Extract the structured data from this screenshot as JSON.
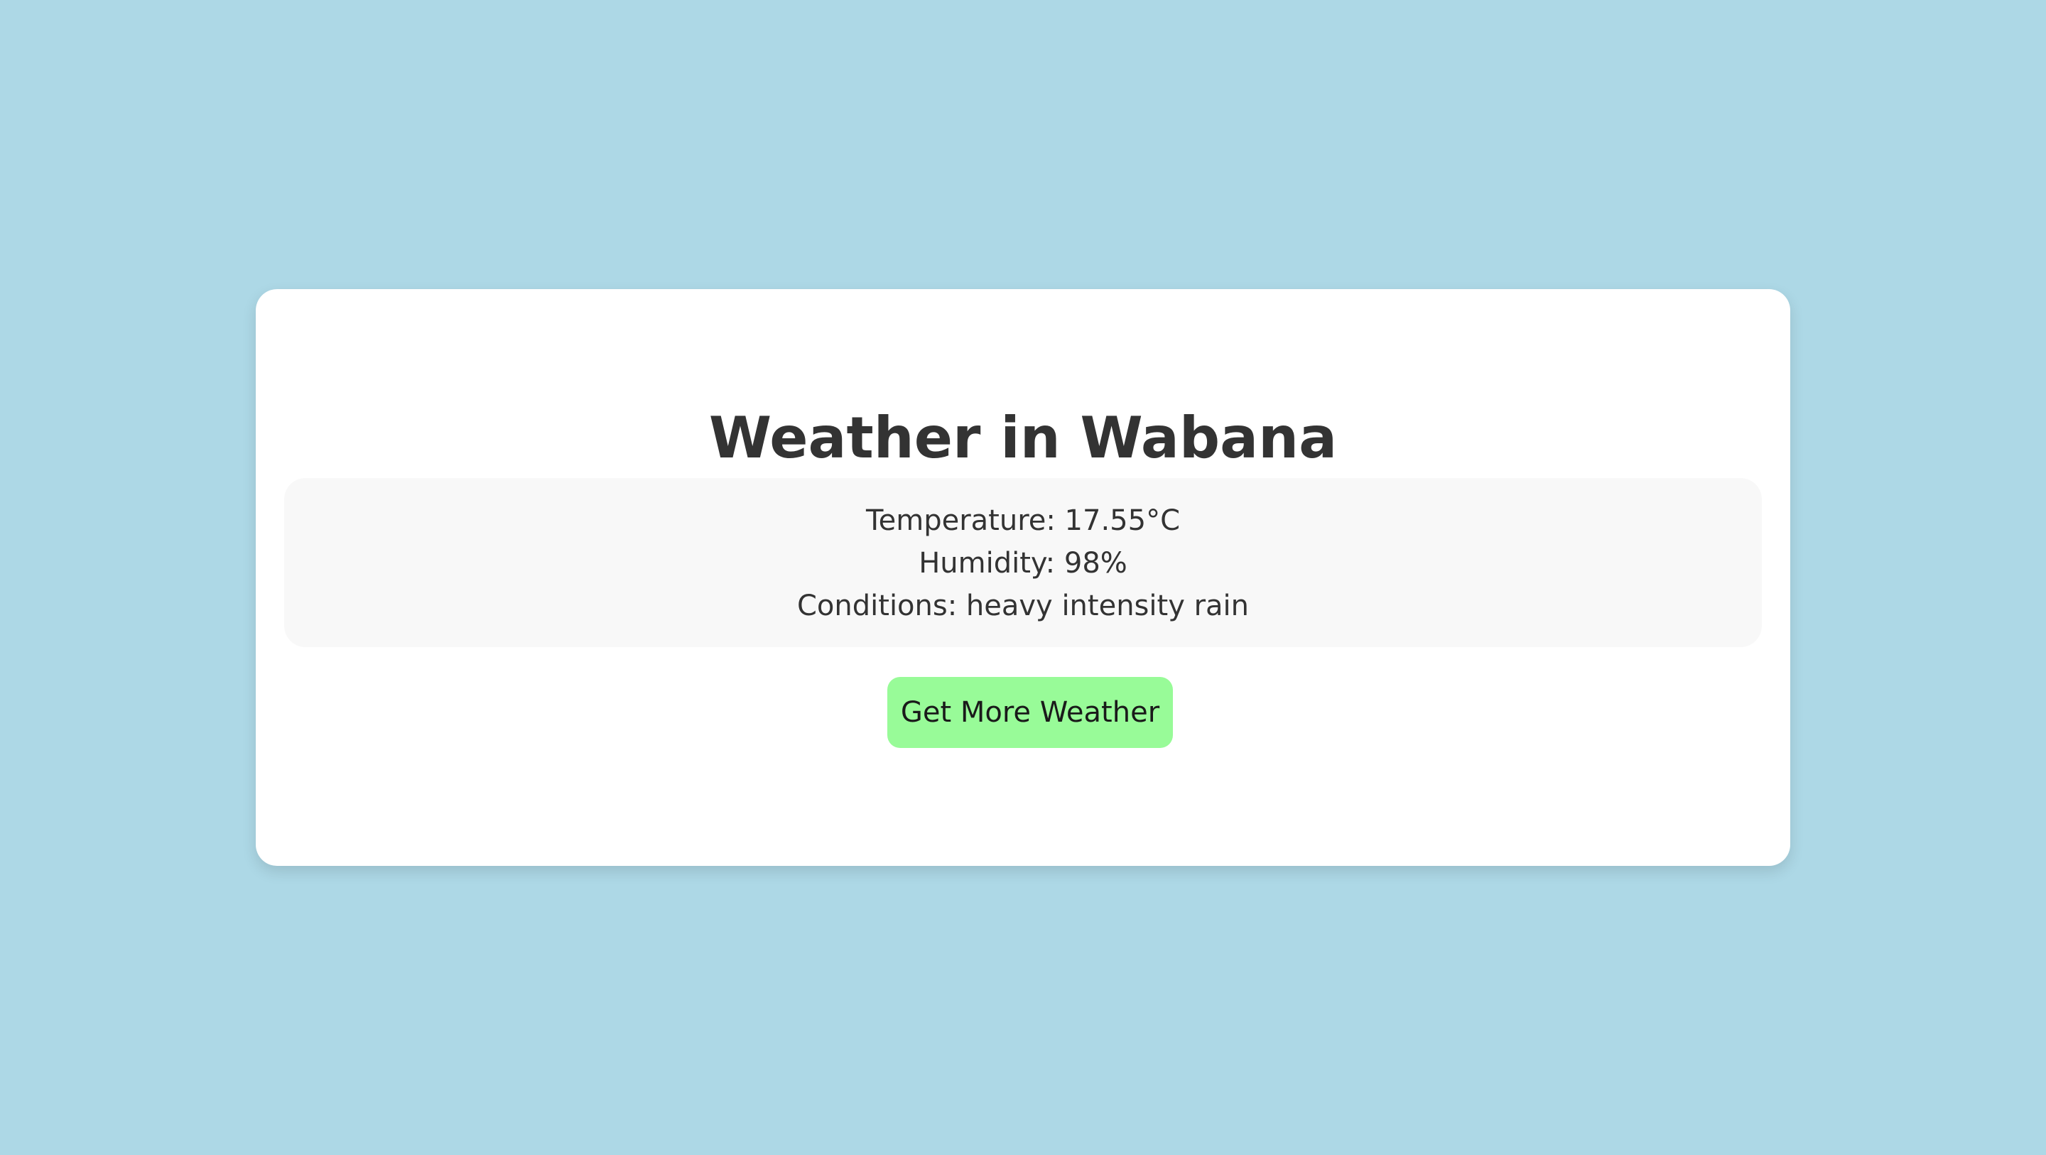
{
  "page": {
    "background_color": "#add8e6",
    "title": "Weather in Wabana"
  },
  "weather": {
    "temperature_text": "Temperature: 17.55°C",
    "humidity_text": "Humidity: 98%",
    "conditions_text": "Conditions: heavy intensity rain"
  },
  "actions": {
    "more_weather_label": "Get More Weather",
    "button_color": "#98fb98"
  }
}
